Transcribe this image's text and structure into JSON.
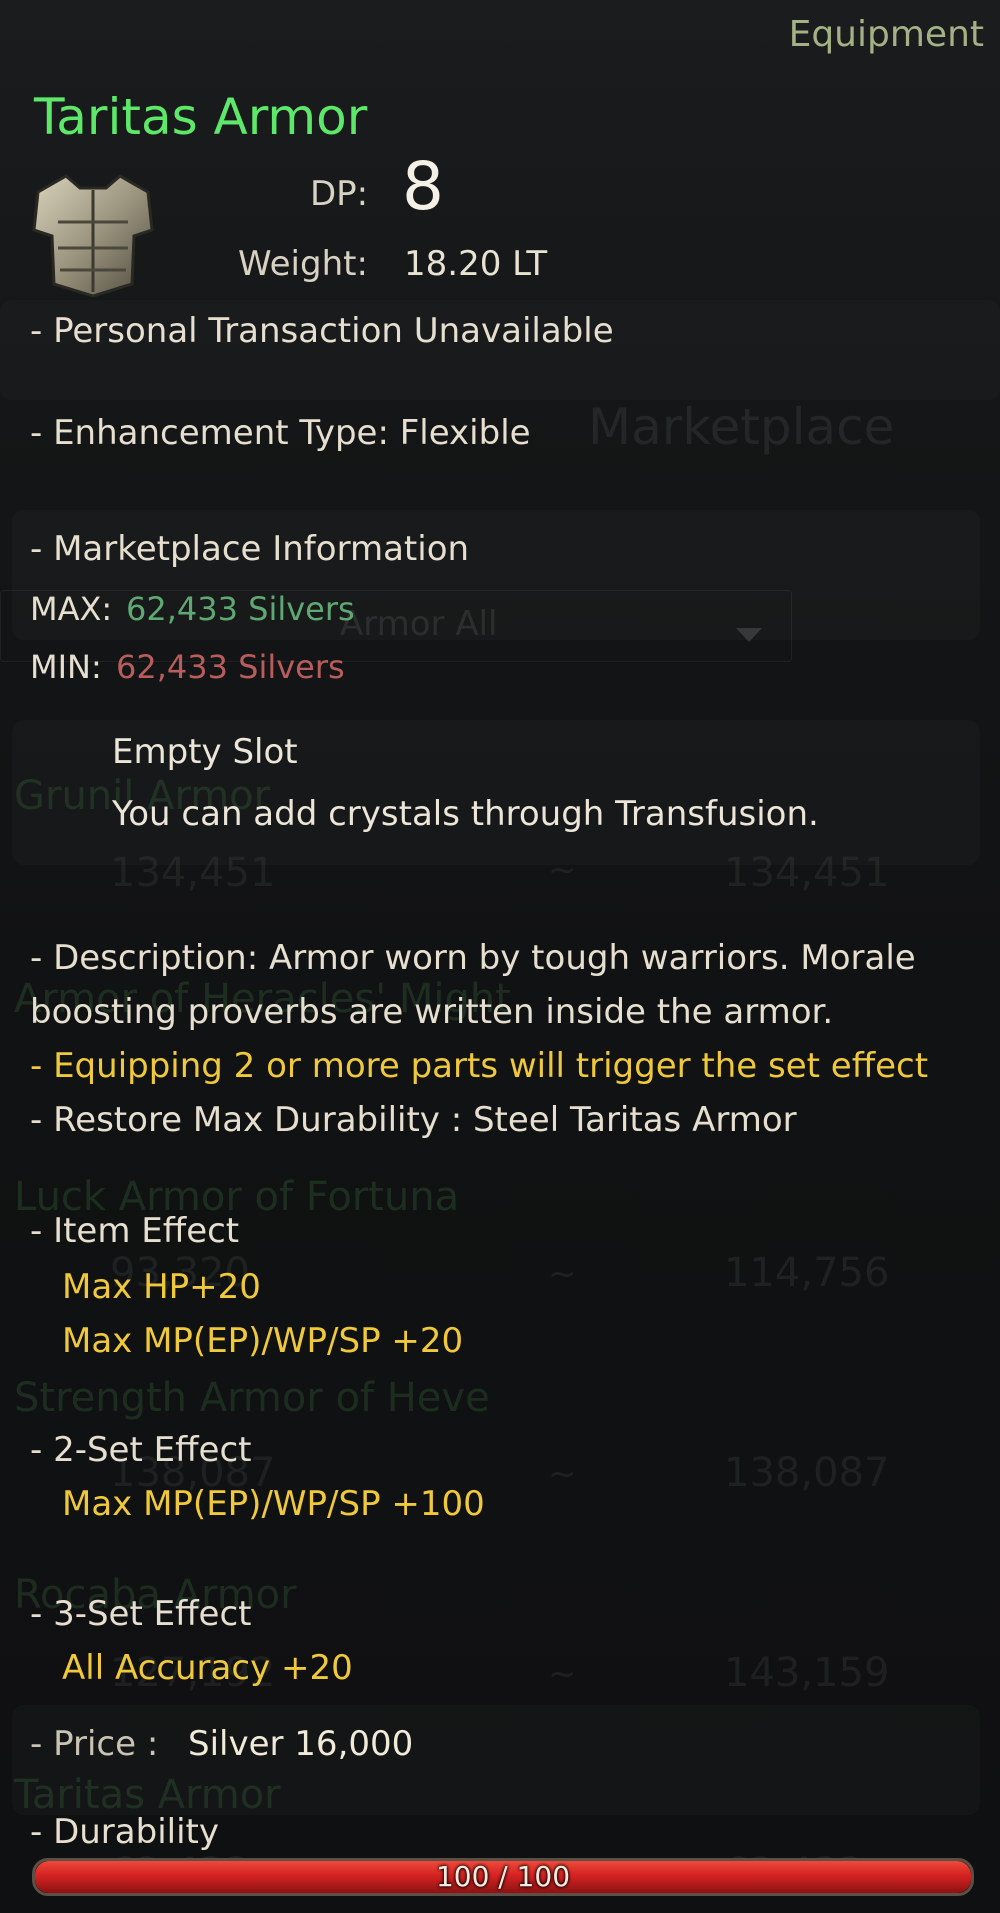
{
  "category": "Equipment",
  "item": {
    "name": "Taritas Armor",
    "icon": "armor-chestplate-icon",
    "dp_label": "DP:",
    "dp_value": "8",
    "weight_label": "Weight:",
    "weight_value": "18.20 LT"
  },
  "lines": {
    "transaction": "- Personal Transaction Unavailable",
    "enhancement": "- Enhancement Type: Flexible",
    "market_info": "- Marketplace Information"
  },
  "market": {
    "max_label": "MAX:",
    "max_value": "62,433 Silvers",
    "min_label": "MIN:",
    "min_value": "62,433 Silvers"
  },
  "slot": {
    "title": "Empty Slot",
    "text": "You can add crystals through Transfusion."
  },
  "description": {
    "line1": "- Description: Armor worn by tough warriors. Morale",
    "line2": "boosting proverbs are written inside the armor.",
    "set_trigger": "- Equipping 2 or more parts will trigger the set effect",
    "restore": "- Restore Max Durability : Steel Taritas Armor"
  },
  "item_effect": {
    "title": "- Item Effect",
    "lines": [
      "Max HP+20",
      "Max MP(EP)/WP/SP +20"
    ]
  },
  "set2": {
    "title": "- 2-Set Effect",
    "lines": [
      "Max MP(EP)/WP/SP +100"
    ]
  },
  "set3": {
    "title": "- 3-Set Effect",
    "lines": [
      "All Accuracy +20"
    ]
  },
  "price": {
    "label": "- Price :",
    "value": "Silver 16,000"
  },
  "durability": {
    "label": "- Durability",
    "text": "100 / 100",
    "fraction": 1.0
  },
  "background": {
    "marketplace_title": "Marketplace",
    "filter": "Armor All",
    "items": [
      {
        "name": "Grunil Armor",
        "low": "134,451",
        "sep": "~",
        "high": "134,451"
      },
      {
        "name": "Armor of Heracles' Might"
      },
      {
        "name": "Luck Armor of Fortuna",
        "low": "93,320",
        "sep": "~",
        "high": "114,756"
      },
      {
        "name": "Strength Armor of Heve",
        "low": "138,087",
        "sep": "~",
        "high": "138,087"
      },
      {
        "name": "Rocaba Armor",
        "low": "127,192",
        "sep": "~",
        "high": "143,159"
      },
      {
        "name": "Taritas Armor",
        "low": "62,433",
        "sep": "~",
        "high": "62,433"
      }
    ]
  },
  "colors": {
    "name_green": "#5ee86a",
    "category_green": "#a3b184",
    "max_green": "#5fa873",
    "min_red": "#b95c5c",
    "effect_yellow": "#f0c93a",
    "durability_red": "#d42222"
  }
}
